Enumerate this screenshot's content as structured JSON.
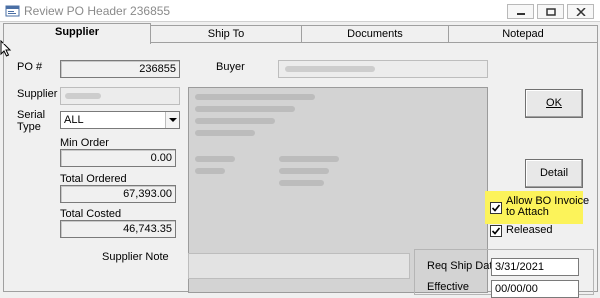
{
  "window": {
    "title": "Review PO Header 236855",
    "icon": "app-window-icon"
  },
  "tabs": [
    "Supplier",
    "Ship To",
    "Documents",
    "Notepad"
  ],
  "active_tab": "Supplier",
  "supplier_tab": {
    "po_label": "PO #",
    "po_value": "236855",
    "buyer_label": "Buyer",
    "supplier_label": "Supplier",
    "serial_type_label": "Serial\nType",
    "serial_type_value": "ALL",
    "min_order_label": "Min Order",
    "min_order_value": "0.00",
    "total_ordered_label": "Total Ordered",
    "total_ordered_value": "67,393.00",
    "total_costed_label": "Total Costed",
    "total_costed_value": "46,743.35",
    "supplier_note_label": "Supplier Note",
    "ok_label": "OK",
    "detail_label": "Detail",
    "allow_bo_label": "Allow BO Invoice\nto Attach",
    "allow_bo_checked": true,
    "released_label": "Released",
    "released_checked": true,
    "req_ship_date_label": "Req Ship Date",
    "req_ship_date_value": "3/31/2021",
    "effective_label": "Effective",
    "effective_value": "00/00/00"
  },
  "colors": {
    "highlight": "#fcf35a",
    "window_bg": "#f0f0f0"
  }
}
